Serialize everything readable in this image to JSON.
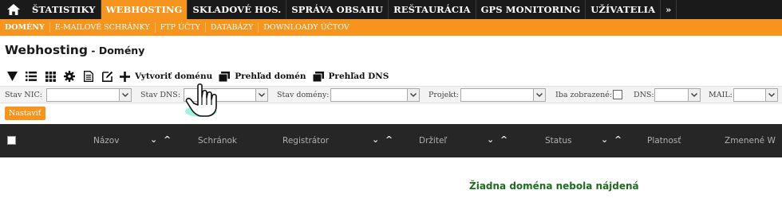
{
  "nav": {
    "items": [
      {
        "label": "ŠTATISTIKY",
        "active": false
      },
      {
        "label": "WEBHOSTING",
        "active": true
      },
      {
        "label": "SKLADOVÉ HOS.",
        "active": false
      },
      {
        "label": "SPRÁVA OBSAHU",
        "active": false
      },
      {
        "label": "REŠTAURÁCIA",
        "active": false
      },
      {
        "label": "GPS MONITORING",
        "active": false
      },
      {
        "label": "UŽÍVATELIA",
        "active": false
      },
      {
        "label": "»",
        "active": false
      }
    ]
  },
  "subnav": {
    "items": [
      {
        "label": "DOMÉNY",
        "active": true
      },
      {
        "label": "E-MAILOVÉ SCHRÁNKY",
        "active": false
      },
      {
        "label": "FTP ÚČTY",
        "active": false
      },
      {
        "label": "DATABÁZY",
        "active": false
      },
      {
        "label": "DOWNLOADY ÚČTOV",
        "active": false
      }
    ]
  },
  "page": {
    "title": "Webhosting",
    "separator": " - ",
    "subtitle": "Domény"
  },
  "toolbar": {
    "create_label": "Vytvoriť doménu",
    "overview_domains_label": "Prehľad domén",
    "overview_dns_label": "Prehľad DNS",
    "icons": [
      "filter-icon",
      "list-icon",
      "grid-icon",
      "gear-icon",
      "document-icon",
      "edit-icon"
    ]
  },
  "filters": {
    "stav_nic": "Stav NIC:",
    "stav_dns": "Stav DNS:",
    "stav_domeny": "Stav domény:",
    "projekt": "Projekt:",
    "iba_zobrazene": "Iba zobrazené:",
    "dns": "DNS:",
    "mail": "MAIL:"
  },
  "set_button": "Nastaviť",
  "table": {
    "columns": {
      "nazov": "Názov",
      "schranok": "Schránok",
      "registrator": "Registrátor",
      "drzitel": "Držiteľ",
      "status": "Status",
      "platnost": "Platnosť",
      "zmenene": "Zmenené W"
    },
    "sort_glyph": "⌄ ^"
  },
  "empty_message": "Žiadna doména nebola nájdená",
  "colors": {
    "accent": "#f7941d",
    "nav_bg": "#1a1a1a",
    "table_header_bg": "#262626",
    "empty_text": "#1b6e1b"
  }
}
